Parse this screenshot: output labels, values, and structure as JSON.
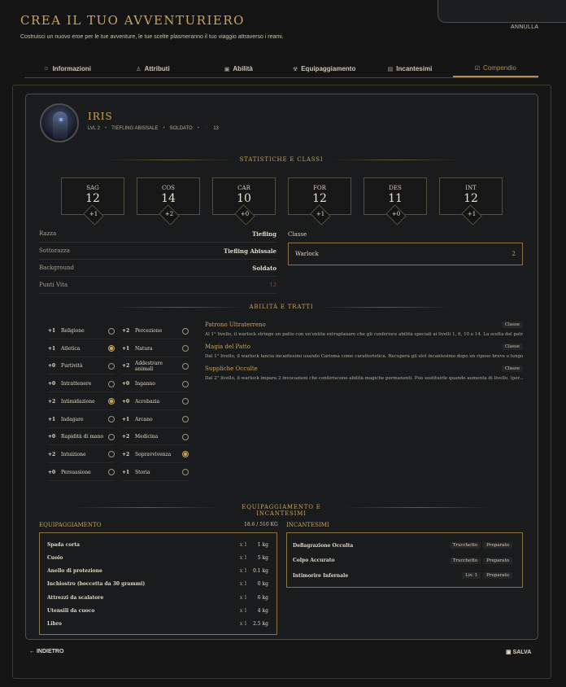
{
  "header": {
    "title": "Crea il tuo avventuriero",
    "subtitle": "Costruisci un nuovo eroe per le tue avventure, le tue scelte plasmeranno il tuo viaggio attraverso i reami.",
    "cancel": "ANNULLA"
  },
  "tabs": [
    {
      "label": "Informazioni",
      "icon": "person-icon"
    },
    {
      "label": "Attributi",
      "icon": "people-icon"
    },
    {
      "label": "Abilità",
      "icon": "book-icon"
    },
    {
      "label": "Equipaggiamento",
      "icon": "bag-icon"
    },
    {
      "label": "Incantesimi",
      "icon": "scroll-icon"
    },
    {
      "label": "Compendio",
      "icon": "check-icon",
      "active": true
    }
  ],
  "hero": {
    "name": "IRIS",
    "level": "LVL 2",
    "race": "TIEFLING ABISSALE",
    "background": "SOLDATO",
    "hp": "13"
  },
  "stats_title": "STATISTICHE E CLASSI",
  "stats": [
    {
      "label": "SAG",
      "value": "12",
      "mod": "+1"
    },
    {
      "label": "COS",
      "value": "14",
      "mod": "+2"
    },
    {
      "label": "CAR",
      "value": "10",
      "mod": "+0"
    },
    {
      "label": "FOR",
      "value": "12",
      "mod": "+1"
    },
    {
      "label": "DES",
      "value": "11",
      "mod": "+0"
    },
    {
      "label": "INT",
      "value": "12",
      "mod": "+1"
    }
  ],
  "info": [
    {
      "k": "Razza",
      "v": "Tiefling"
    },
    {
      "k": "Sottorazza",
      "v": "Tiefling Abissale"
    },
    {
      "k": "Background",
      "v": "Soldato"
    },
    {
      "k": "Punti Vita",
      "v": "13"
    }
  ],
  "classes": {
    "label": "Classe",
    "name": "Warlock",
    "level": "2"
  },
  "skills_title": "ABILITÀ E TRATTI",
  "skills_left": [
    {
      "mod": "+1",
      "name": "Religione",
      "on": false
    },
    {
      "mod": "+1",
      "name": "Atletica",
      "on": true
    },
    {
      "mod": "+0",
      "name": "Furtività",
      "on": false
    },
    {
      "mod": "+0",
      "name": "Intrattenere",
      "on": false
    },
    {
      "mod": "+2",
      "name": "Intimidazione",
      "on": true
    },
    {
      "mod": "+1",
      "name": "Indagare",
      "on": false
    },
    {
      "mod": "+0",
      "name": "Rapidità di mano",
      "on": false
    },
    {
      "mod": "+2",
      "name": "Intuizione",
      "on": false
    },
    {
      "mod": "+0",
      "name": "Persuasione",
      "on": false
    }
  ],
  "skills_right": [
    {
      "mod": "+2",
      "name": "Percezione",
      "on": false
    },
    {
      "mod": "+1",
      "name": "Natura",
      "on": false
    },
    {
      "mod": "+2",
      "name": "Addestrare animali",
      "on": false
    },
    {
      "mod": "+0",
      "name": "Inganno",
      "on": false
    },
    {
      "mod": "+0",
      "name": "Acrobazia",
      "on": false
    },
    {
      "mod": "+1",
      "name": "Arcano",
      "on": false
    },
    {
      "mod": "+2",
      "name": "Medicina",
      "on": false
    },
    {
      "mod": "+2",
      "name": "Sopravvivenza",
      "on": true
    },
    {
      "mod": "+1",
      "name": "Storia",
      "on": false
    }
  ],
  "traits": [
    {
      "title": "Patrono Ultraterreno",
      "tag": "Classe",
      "desc": "Al 1° livello, il warlock stringe un patto con un'entità extraplanare che gli conferisce abilità speciali ai livelli 1, 6, 10 e 14. La scelta del patrono..."
    },
    {
      "title": "Magia del Patto",
      "tag": "Classe",
      "desc": "Dal 1° livello, il warlock lancia incantesimi usando Carisma come caratteristica. Recupera gli slot incantesimo dopo un riposo breve o lungo..."
    },
    {
      "title": "Suppliche Occulte",
      "tag": "Classe",
      "desc": "Dal 2° livello, il warlock impara 2 invocazioni che conferiscono abilità magiche permanenti. Può sostituirle quando aumenta di livello. (per..."
    }
  ],
  "equip_section_title": "EQUIPAGGIAMENTO E INCANTESIMI",
  "equipment": {
    "title": "EQUIPAGGIAMENTO",
    "weight": "18.6 / 510 KG",
    "items": [
      {
        "name": "Spada corta",
        "qty": "x 1",
        "weight": "1 kg"
      },
      {
        "name": "Cuoio",
        "qty": "x 1",
        "weight": "5 kg"
      },
      {
        "name": "Anello di protezione",
        "qty": "x 1",
        "weight": "0.1 kg"
      },
      {
        "name": "Inchiostro (boccetta da 30 grammi)",
        "qty": "x 1",
        "weight": "0 kg"
      },
      {
        "name": "Attrezzi da scalatore",
        "qty": "x 1",
        "weight": "6 kg"
      },
      {
        "name": "Utensili da cuoco",
        "qty": "x 1",
        "weight": "4 kg"
      },
      {
        "name": "Libro",
        "qty": "x 1",
        "weight": "2.5 kg"
      }
    ]
  },
  "spells": {
    "title": "INCANTESIMI",
    "items": [
      {
        "name": "Deflagrazione Occulta",
        "tag1": "Trucchetto",
        "tag2": "Preparato"
      },
      {
        "name": "Colpo Accurato",
        "tag1": "Trucchetto",
        "tag2": "Preparato"
      },
      {
        "name": "Intimorire Infernale",
        "tag1": "Liv. 1",
        "tag2": "Preparato"
      }
    ]
  },
  "footer": {
    "back": "INDIETRO",
    "save": "SALVA"
  }
}
